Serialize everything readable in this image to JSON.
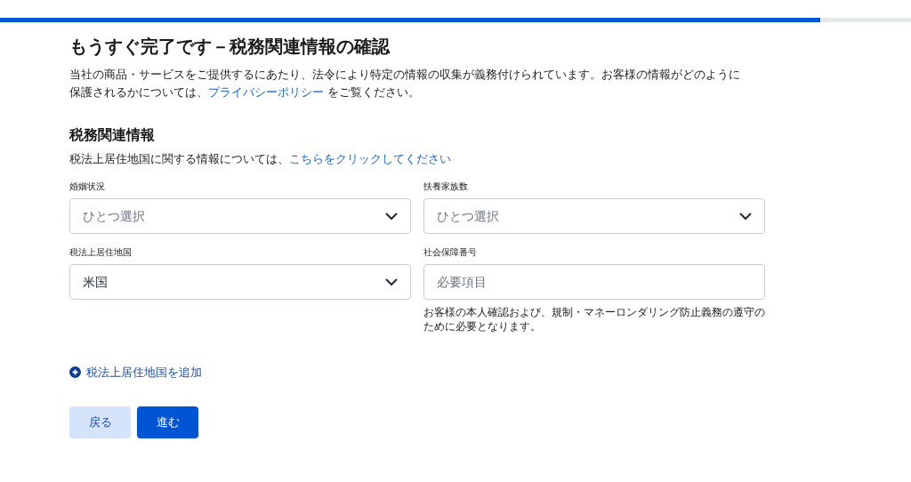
{
  "progress": {
    "level": 0.9
  },
  "title": "もうすぐ完了です－税務関連情報の確認",
  "intro": {
    "before": "当社の商品・サービスをご提供するにあたり、法令により特定の情報の収集が義務付けられています。お客様の情報がどのように保護されるかについては、",
    "link": "プライバシーポリシー",
    "after": " をご覧ください。"
  },
  "section": {
    "heading": "税務関連情報",
    "note": {
      "before": "税法上居住地国に関する情報については、",
      "link": "こちらをクリックしてください"
    }
  },
  "fields": [
    {
      "label": "婚姻状況",
      "kind": "select",
      "placeholder": "ひとつ選択"
    },
    {
      "label": "扶養家族数",
      "kind": "select",
      "placeholder": "ひとつ選択"
    },
    {
      "label": "税法上居住地国",
      "kind": "select",
      "value": "米国"
    },
    {
      "label": "社会保障番号",
      "kind": "input",
      "placeholder": "必要項目",
      "help": "お客様の本人確認および、規制・マネーロンダリング防止義務の遵守のために必要となります。"
    }
  ],
  "add_link": "税法上居住地国を追加",
  "buttons": [
    {
      "label": "戻る",
      "kind": "secondary"
    },
    {
      "label": "進む",
      "kind": "primary"
    }
  ]
}
